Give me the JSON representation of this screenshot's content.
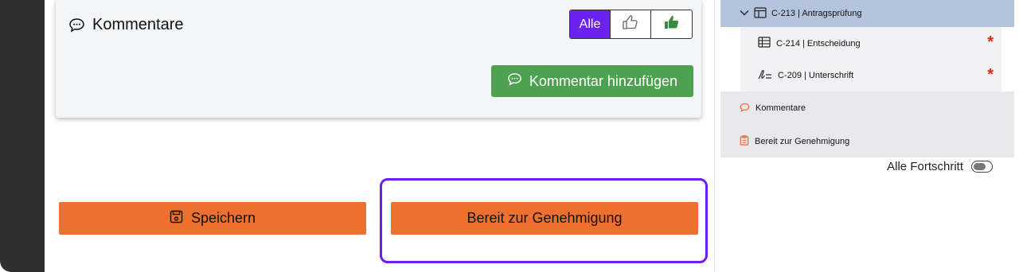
{
  "comments_panel": {
    "title": "Kommentare",
    "filter": {
      "all_label": "Alle",
      "active": "all"
    },
    "add_comment_label": "Kommentar hinzufügen"
  },
  "progress": {
    "toggle_label": "Alle Fortschritt",
    "toggle_on": false
  },
  "actions": {
    "save_label": "Speichern",
    "approve_label": "Bereit zur Genehmigung"
  },
  "tree": {
    "items": [
      {
        "label": "C-213 | Antragsprüfung",
        "icon": "layout-icon",
        "expanded": true,
        "selected": true
      },
      {
        "label": "C-214 | Entscheidung",
        "icon": "table-icon",
        "required": true
      },
      {
        "label": "C-209 | Unterschrift",
        "icon": "signature-icon",
        "required": true
      },
      {
        "label": "Kommentare",
        "icon": "comment-icon"
      },
      {
        "label": "Bereit zur Genehmigung",
        "icon": "clipboard-icon"
      }
    ],
    "required_marker": "*"
  },
  "colors": {
    "accent_purple": "#6b22f0",
    "action_orange": "#ee7030",
    "add_green": "#4fa152",
    "tree_selected": "#b5c4dd",
    "required_red": "#e5231b"
  }
}
